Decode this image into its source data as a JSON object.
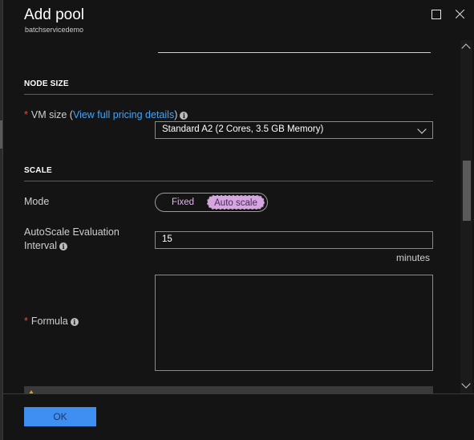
{
  "window": {
    "title": "Add pool",
    "subtitle": "batchservicedemo"
  },
  "node_size": {
    "heading": "NODE SIZE",
    "vm_size_label_prefix": "VM size (",
    "vm_size_link": "View full pricing details",
    "vm_size_label_suffix": ")",
    "vm_size_value": "Standard A2 (2 Cores, 3.5 GB Memory)"
  },
  "scale": {
    "heading": "SCALE",
    "mode_label": "Mode",
    "mode_options": [
      "Fixed",
      "Auto scale"
    ],
    "mode_selected": "Auto scale",
    "interval_label_line1": "AutoScale Evaluation",
    "interval_label_line2": "Interval",
    "interval_value": "15",
    "interval_unit": "minutes",
    "formula_label": "Formula",
    "formula_value": ""
  },
  "footer": {
    "ok_label": "OK"
  },
  "colors": {
    "accent_blue": "#3f8ff3",
    "link_blue": "#4aa3f0",
    "required_red": "#e74c3c",
    "toggle_selected": "#d5a6e0"
  }
}
